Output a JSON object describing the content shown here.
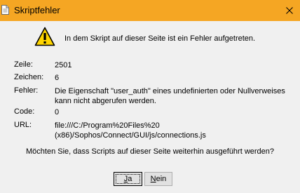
{
  "window": {
    "title": "Skriptfehler",
    "titlebar_color": "#f5a623"
  },
  "icons": {
    "title": "script-page-icon",
    "warning": "warning-icon",
    "close": "close-icon"
  },
  "message": "In dem Skript auf dieser Seite ist ein Fehler aufgetreten.",
  "details": {
    "line": {
      "label": "Zeile:",
      "value": "2501"
    },
    "char": {
      "label": "Zeichen:",
      "value": "6"
    },
    "error": {
      "label": "Fehler:",
      "value_line1": "Die Eigenschaft \"user_auth\" eines undefinierten oder Nullverweises",
      "value_line2": "kann nicht abgerufen werden."
    },
    "code": {
      "label": "Code:",
      "value": "0"
    },
    "url": {
      "label": "URL:",
      "value_line1": "file:///C:/Program%20Files%20",
      "value_line2": "(x86)/Sophos/Connect/GUI/js/connections.js"
    }
  },
  "question": "Möchten Sie, dass Scripts auf dieser Seite weiterhin ausgeführt werden?",
  "buttons": {
    "yes_mnemonic": "J",
    "yes_rest": "a",
    "no_mnemonic": "N",
    "no_rest": "ein"
  }
}
